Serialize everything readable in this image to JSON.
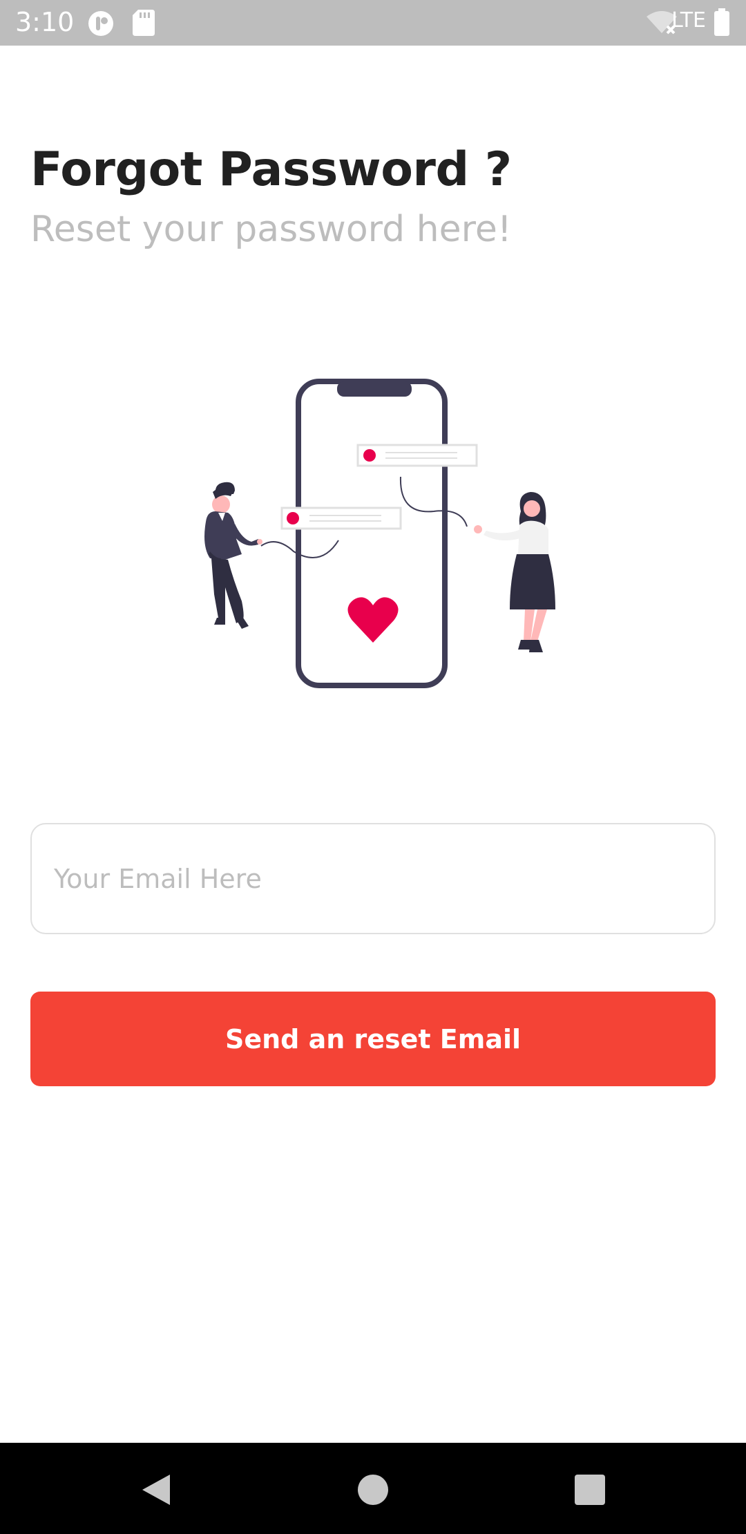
{
  "status_bar": {
    "time": "3:10",
    "network": "LTE",
    "icons": [
      "notification-app-icon",
      "sd-card-icon",
      "wifi-off-icon",
      "signal-icon",
      "battery-icon"
    ]
  },
  "header": {
    "title": "Forgot Password ?",
    "subtitle": "Reset your password here!"
  },
  "form": {
    "email_placeholder": "Your Email Here",
    "email_value": "",
    "submit_label": "Send an reset Email"
  },
  "colors": {
    "accent": "#f44336",
    "title": "#212121",
    "subtitle": "#bdbdbd",
    "illustration_accent": "#e8004c",
    "illustration_dark": "#3f3d56"
  },
  "nav_bar": {
    "icons": [
      "back-icon",
      "home-icon",
      "recents-icon"
    ]
  }
}
